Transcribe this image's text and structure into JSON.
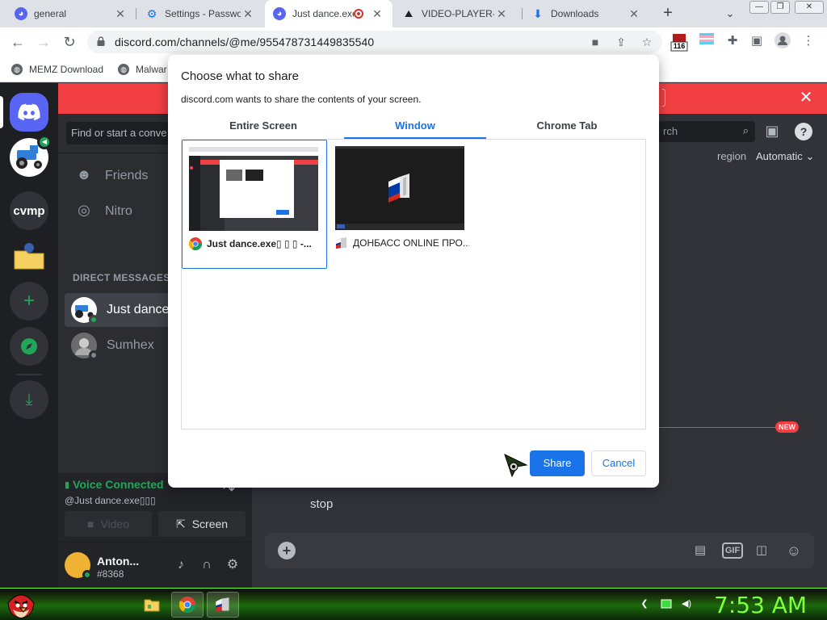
{
  "browser": {
    "tabs": [
      {
        "title": "general",
        "favicon": "discord-icon"
      },
      {
        "title": "Settings - Passwo",
        "favicon": "gear-icon"
      },
      {
        "title": "Just dance.exe",
        "favicon": "discord-icon",
        "recording": true
      },
      {
        "title": "VIDEO-PLAYER-G",
        "favicon": "triangle-icon"
      },
      {
        "title": "Downloads",
        "favicon": "download-icon"
      }
    ],
    "url": "discord.com/channels/@me/955478731449835540",
    "extension_badge": "116",
    "bookmarks": [
      {
        "label": "MEMZ Download"
      },
      {
        "label": "Malwar"
      }
    ],
    "window_controls": [
      "—",
      "❐",
      "✕"
    ]
  },
  "discord": {
    "servers": [
      {
        "name": "home",
        "label": ""
      },
      {
        "name": "tractor-server",
        "label": ""
      },
      {
        "name": "cvmp",
        "label": "cvmp"
      },
      {
        "name": "folder-server",
        "label": ""
      }
    ],
    "search_placeholder": "Find or start a conve",
    "nav": {
      "friends": "Friends",
      "nitro": "Nitro"
    },
    "dm_header": "DIRECT MESSAGES",
    "dms": [
      {
        "name": "Just dance.",
        "status_color": "#23a559"
      },
      {
        "name": "Sumhex",
        "status_color": "#80848e"
      }
    ],
    "voice": {
      "status": "Voice Connected",
      "channel": "@Just dance.exe▯▯▯",
      "video_label": "Video",
      "screen_label": "Screen"
    },
    "user": {
      "name": "Anton...",
      "tag": "#8368"
    },
    "header_search": "rch",
    "region_label": "region",
    "region_value": "Automatic",
    "new_badge": "NEW",
    "message": "stop",
    "composer_gif": "GIF"
  },
  "dialog": {
    "title": "Choose what to share",
    "subtitle": "discord.com wants to share the contents of your screen.",
    "tabs": [
      "Entire Screen",
      "Window",
      "Chrome Tab"
    ],
    "active_tab": "Window",
    "sources": [
      {
        "label": "Just dance.exe▯ ▯ ▯ -...",
        "selected": true
      },
      {
        "label": "ДОНБАСС ONLINE ПРО...",
        "selected": false
      }
    ],
    "share_label": "Share",
    "cancel_label": "Cancel"
  },
  "taskbar": {
    "clock": "7:53 AM"
  },
  "colors": {
    "discord_blurple": "#5865f2",
    "chrome_blue": "#1a73e8",
    "discord_red": "#f23f43",
    "voice_green": "#23a559",
    "clock_green": "#7dff3a"
  }
}
